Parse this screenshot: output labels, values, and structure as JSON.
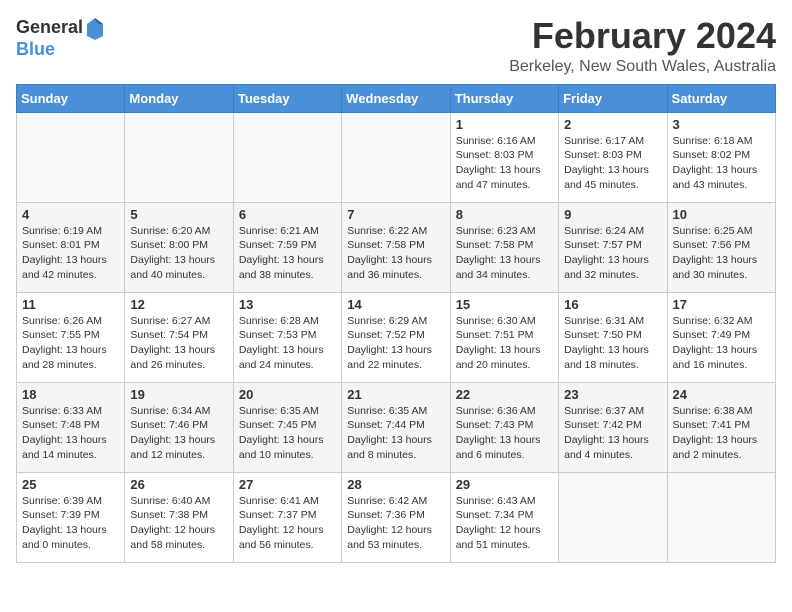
{
  "header": {
    "logo_general": "General",
    "logo_blue": "Blue",
    "title": "February 2024",
    "subtitle": "Berkeley, New South Wales, Australia"
  },
  "days_of_week": [
    "Sunday",
    "Monday",
    "Tuesday",
    "Wednesday",
    "Thursday",
    "Friday",
    "Saturday"
  ],
  "weeks": [
    [
      {
        "day": "",
        "info": ""
      },
      {
        "day": "",
        "info": ""
      },
      {
        "day": "",
        "info": ""
      },
      {
        "day": "",
        "info": ""
      },
      {
        "day": "1",
        "info": "Sunrise: 6:16 AM\nSunset: 8:03 PM\nDaylight: 13 hours and 47 minutes."
      },
      {
        "day": "2",
        "info": "Sunrise: 6:17 AM\nSunset: 8:03 PM\nDaylight: 13 hours and 45 minutes."
      },
      {
        "day": "3",
        "info": "Sunrise: 6:18 AM\nSunset: 8:02 PM\nDaylight: 13 hours and 43 minutes."
      }
    ],
    [
      {
        "day": "4",
        "info": "Sunrise: 6:19 AM\nSunset: 8:01 PM\nDaylight: 13 hours and 42 minutes."
      },
      {
        "day": "5",
        "info": "Sunrise: 6:20 AM\nSunset: 8:00 PM\nDaylight: 13 hours and 40 minutes."
      },
      {
        "day": "6",
        "info": "Sunrise: 6:21 AM\nSunset: 7:59 PM\nDaylight: 13 hours and 38 minutes."
      },
      {
        "day": "7",
        "info": "Sunrise: 6:22 AM\nSunset: 7:58 PM\nDaylight: 13 hours and 36 minutes."
      },
      {
        "day": "8",
        "info": "Sunrise: 6:23 AM\nSunset: 7:58 PM\nDaylight: 13 hours and 34 minutes."
      },
      {
        "day": "9",
        "info": "Sunrise: 6:24 AM\nSunset: 7:57 PM\nDaylight: 13 hours and 32 minutes."
      },
      {
        "day": "10",
        "info": "Sunrise: 6:25 AM\nSunset: 7:56 PM\nDaylight: 13 hours and 30 minutes."
      }
    ],
    [
      {
        "day": "11",
        "info": "Sunrise: 6:26 AM\nSunset: 7:55 PM\nDaylight: 13 hours and 28 minutes."
      },
      {
        "day": "12",
        "info": "Sunrise: 6:27 AM\nSunset: 7:54 PM\nDaylight: 13 hours and 26 minutes."
      },
      {
        "day": "13",
        "info": "Sunrise: 6:28 AM\nSunset: 7:53 PM\nDaylight: 13 hours and 24 minutes."
      },
      {
        "day": "14",
        "info": "Sunrise: 6:29 AM\nSunset: 7:52 PM\nDaylight: 13 hours and 22 minutes."
      },
      {
        "day": "15",
        "info": "Sunrise: 6:30 AM\nSunset: 7:51 PM\nDaylight: 13 hours and 20 minutes."
      },
      {
        "day": "16",
        "info": "Sunrise: 6:31 AM\nSunset: 7:50 PM\nDaylight: 13 hours and 18 minutes."
      },
      {
        "day": "17",
        "info": "Sunrise: 6:32 AM\nSunset: 7:49 PM\nDaylight: 13 hours and 16 minutes."
      }
    ],
    [
      {
        "day": "18",
        "info": "Sunrise: 6:33 AM\nSunset: 7:48 PM\nDaylight: 13 hours and 14 minutes."
      },
      {
        "day": "19",
        "info": "Sunrise: 6:34 AM\nSunset: 7:46 PM\nDaylight: 13 hours and 12 minutes."
      },
      {
        "day": "20",
        "info": "Sunrise: 6:35 AM\nSunset: 7:45 PM\nDaylight: 13 hours and 10 minutes."
      },
      {
        "day": "21",
        "info": "Sunrise: 6:35 AM\nSunset: 7:44 PM\nDaylight: 13 hours and 8 minutes."
      },
      {
        "day": "22",
        "info": "Sunrise: 6:36 AM\nSunset: 7:43 PM\nDaylight: 13 hours and 6 minutes."
      },
      {
        "day": "23",
        "info": "Sunrise: 6:37 AM\nSunset: 7:42 PM\nDaylight: 13 hours and 4 minutes."
      },
      {
        "day": "24",
        "info": "Sunrise: 6:38 AM\nSunset: 7:41 PM\nDaylight: 13 hours and 2 minutes."
      }
    ],
    [
      {
        "day": "25",
        "info": "Sunrise: 6:39 AM\nSunset: 7:39 PM\nDaylight: 13 hours and 0 minutes."
      },
      {
        "day": "26",
        "info": "Sunrise: 6:40 AM\nSunset: 7:38 PM\nDaylight: 12 hours and 58 minutes."
      },
      {
        "day": "27",
        "info": "Sunrise: 6:41 AM\nSunset: 7:37 PM\nDaylight: 12 hours and 56 minutes."
      },
      {
        "day": "28",
        "info": "Sunrise: 6:42 AM\nSunset: 7:36 PM\nDaylight: 12 hours and 53 minutes."
      },
      {
        "day": "29",
        "info": "Sunrise: 6:43 AM\nSunset: 7:34 PM\nDaylight: 12 hours and 51 minutes."
      },
      {
        "day": "",
        "info": ""
      },
      {
        "day": "",
        "info": ""
      }
    ]
  ]
}
